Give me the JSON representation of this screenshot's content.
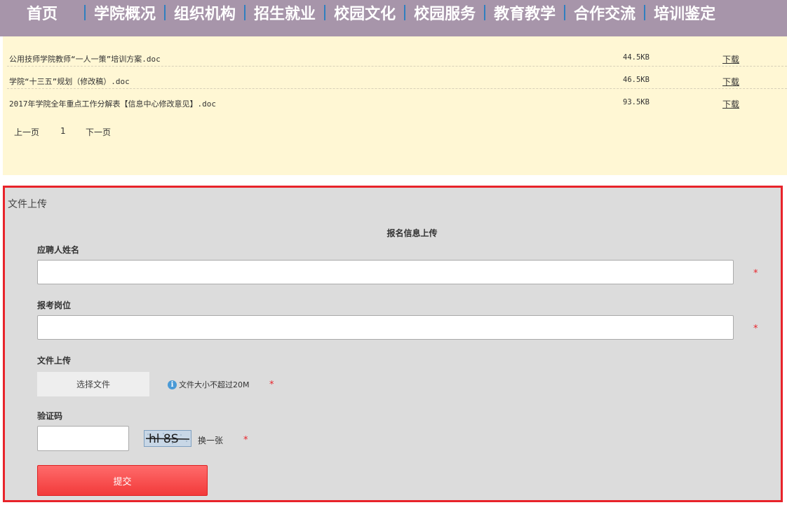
{
  "nav": {
    "items": [
      "首页",
      "学院概况",
      "组织机构",
      "招生就业",
      "校园文化",
      "校园服务",
      "教育教学",
      "合作交流",
      "培训鉴定"
    ]
  },
  "downloads": {
    "rows": [
      {
        "name": "公用技师学院教师“一人一策”培训方案.doc",
        "size": "44.5KB",
        "action": "下载"
      },
      {
        "name": "学院“十三五”规划（修改稿）.doc",
        "size": "46.5KB",
        "action": "下载"
      },
      {
        "name": "2017年学院全年重点工作分解表【信息中心修改意见】.doc",
        "size": "93.5KB",
        "action": "下载"
      }
    ],
    "pager": {
      "prev": "上一页",
      "page": "1",
      "next": "下一页"
    }
  },
  "upload": {
    "panel_title": "文件上传",
    "form_title": "报名信息上传",
    "name_label": "应聘人姓名",
    "name_value": "",
    "position_label": "报考岗位",
    "position_value": "",
    "file_label": "文件上传",
    "file_button": "选择文件",
    "file_hint": "文件大小不超过20M",
    "captcha_label": "验证码",
    "captcha_value": "",
    "captcha_text": "hl 8S",
    "captcha_refresh": "换一张",
    "required_mark": "*",
    "submit_label": "提交"
  },
  "colors": {
    "nav_bg": "#a795aa",
    "nav_separator": "#2f7fc0",
    "downloads_bg": "#fff7d4",
    "upload_bg": "#dcdcdc",
    "upload_border": "#e8232a",
    "submit_bg": "#f23a3a",
    "required": "#e8232a"
  },
  "icons": [
    "info-icon"
  ]
}
